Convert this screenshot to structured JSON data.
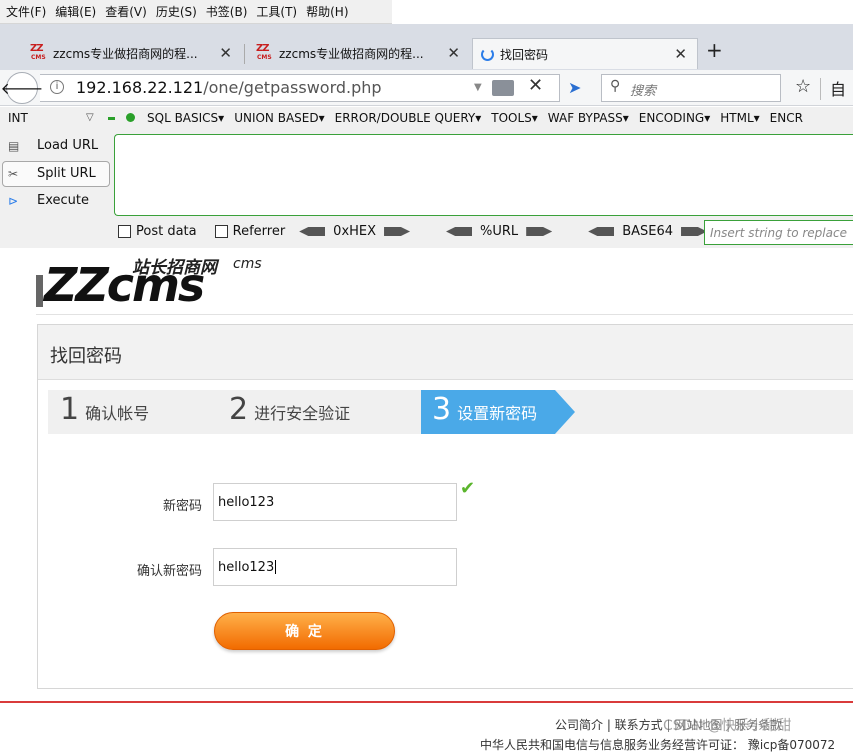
{
  "menubar": {
    "items": [
      "文件(F)",
      "编辑(E)",
      "查看(V)",
      "历史(S)",
      "书签(B)",
      "工具(T)",
      "帮助(H)"
    ]
  },
  "tabs": [
    {
      "title": "zzcms专业做招商网的程...",
      "icon": "zzcms-favicon"
    },
    {
      "title": "zzcms专业做招商网的程...",
      "icon": "zzcms-favicon"
    },
    {
      "title": "找回密码",
      "icon": "loading-spinner"
    }
  ],
  "navbar": {
    "url_host": "192.168.22.121",
    "url_path": "/one/getpassword.php",
    "search_placeholder": "搜索"
  },
  "hackbar": {
    "type_select": "INT",
    "menu": [
      "SQL BASICS▾",
      "UNION BASED▾",
      "ERROR/DOUBLE QUERY▾",
      "TOOLS▾",
      "WAF BYPASS▾",
      "ENCODING▾",
      "HTML▾",
      "ENCR"
    ],
    "load_url": "Load URL",
    "split_url": "Split URL",
    "execute": "Execute",
    "post_data": "Post data",
    "referrer": "Referrer",
    "hex": "0xHEX",
    "url": "%URL",
    "base64": "BASE64",
    "insert_placeholder": "Insert string to replace"
  },
  "logo": {
    "brand": "ZZcms",
    "cn": "站长招商网",
    "suffix": "cms"
  },
  "page": {
    "title": "找回密码",
    "steps": [
      {
        "n": "1",
        "label": "确认帐号"
      },
      {
        "n": "2",
        "label": "进行安全验证"
      },
      {
        "n": "3",
        "label": "设置新密码",
        "active": true
      }
    ],
    "new_password_label": "新密码",
    "new_password_value": "hello123",
    "confirm_label": "确认新密码",
    "confirm_value": "hello123",
    "submit": "确 定"
  },
  "footer": {
    "line1": "公司简介 | 联系方式 | 网站地图 | 服务条款",
    "line2": "中华人民共和国电信与信息服务业务经营许可证：  豫icp备070072",
    "watermark": "CSDN @快乐小甜甜"
  },
  "colors": {
    "accent_blue": "#4aa9e8",
    "button_orange": "#f26b00",
    "footer_red": "#d93b3b",
    "hackbar_green": "#3aa13a"
  }
}
